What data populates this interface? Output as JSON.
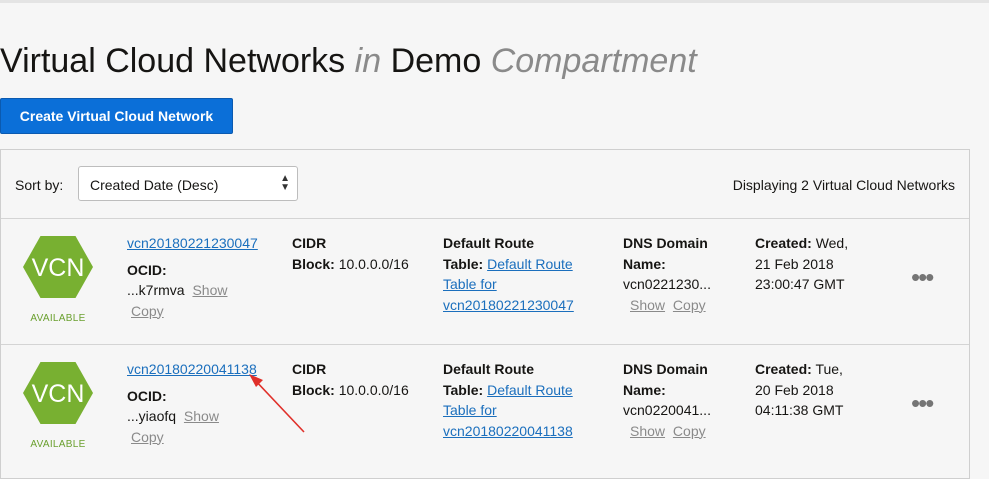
{
  "header": {
    "title_main": "Virtual Cloud Networks",
    "title_in": "in",
    "compartment_name": "Demo",
    "compartment_word": "Compartment"
  },
  "create_button_label": "Create Virtual Cloud Network",
  "toolbar": {
    "sort_label": "Sort by:",
    "sort_value": "Created Date (Desc)",
    "display_count": "Displaying 2 Virtual Cloud Networks"
  },
  "labels": {
    "vcn_icon_text": "VCN",
    "ocid": "OCID:",
    "show": "Show",
    "copy": "Copy",
    "cidr_label_1": "CIDR",
    "cidr_label_2": "Block:",
    "route_label_1": "Default Route",
    "route_label_2": "Table:",
    "dns_label_1": "DNS Domain",
    "dns_label_2": "Name:",
    "created_label": "Created:",
    "more": "•••"
  },
  "colors": {
    "accent": "#0b6fd8",
    "vcn_hex": "#78b031",
    "available": "#6aa02e",
    "annotation_arrow": "#e0302a"
  },
  "vcns": [
    {
      "name": "vcn20180221230047",
      "status": "AVAILABLE",
      "ocid_short": "...k7rmva",
      "cidr": "10.0.0.0/16",
      "route_link_1": "Default Route",
      "route_link_2": "Table for",
      "route_link_3": "vcn20180221230047",
      "dns_short": "vcn0221230...",
      "created_1": "Wed,",
      "created_2": "21 Feb 2018",
      "created_3": "23:00:47 GMT"
    },
    {
      "name": "vcn20180220041138",
      "status": "AVAILABLE",
      "ocid_short": "...yiaofq",
      "cidr": "10.0.0.0/16",
      "route_link_1": "Default Route",
      "route_link_2": "Table for",
      "route_link_3": "vcn20180220041138",
      "dns_short": "vcn0220041...",
      "created_1": "Tue,",
      "created_2": "20 Feb 2018",
      "created_3": "04:11:38 GMT"
    }
  ]
}
